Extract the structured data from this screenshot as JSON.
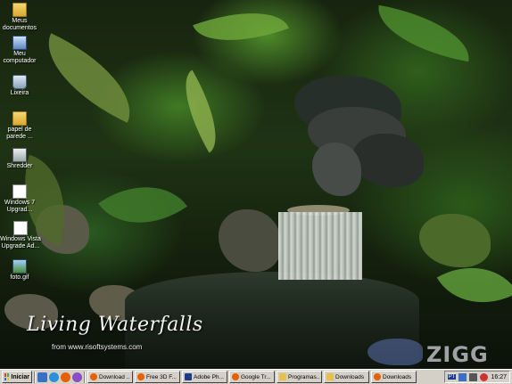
{
  "desktop": {
    "icons": [
      {
        "label": "Meus\ndocumentos",
        "icon": "my-documents-folder-icon"
      },
      {
        "label": "Meu\ncomputador",
        "icon": "my-computer-icon"
      },
      {
        "label": "Lixeira",
        "icon": "recycle-bin-icon"
      },
      {
        "label": "papel de\nparede ...",
        "icon": "folder-icon"
      },
      {
        "label": "Shredder",
        "icon": "shredder-icon"
      },
      {
        "label": "Windows 7\nUpgrad...",
        "icon": "document-icon"
      },
      {
        "label": "Windows Vista\nUpgrade Ad...",
        "icon": "document-icon"
      },
      {
        "label": "foto.gif",
        "icon": "image-file-icon"
      }
    ]
  },
  "wallpaper": {
    "brand": "Living Waterfalls",
    "url": "from www.risoftsystems.com",
    "watermark": "ZIGG"
  },
  "taskbar": {
    "start_label": "Iniciar",
    "quick_launch": [
      "show-desktop-icon",
      "internet-explorer-icon",
      "media-player-icon",
      "browser-icon"
    ],
    "buttons": [
      {
        "label": "Download ...",
        "icon": "firefox-icon"
      },
      {
        "label": "Free 3D F...",
        "icon": "firefox-icon"
      },
      {
        "label": "Adobe Ph...",
        "icon": "photoshop-icon"
      },
      {
        "label": "Google Tr...",
        "icon": "firefox-icon"
      },
      {
        "label": "Programas...",
        "icon": "folder-icon"
      },
      {
        "label": "Downloads",
        "icon": "folder-icon"
      },
      {
        "label": "Downloads",
        "icon": "firefox-icon"
      }
    ],
    "tray": {
      "icons": [
        "pt-language-icon",
        "network-icon",
        "volume-icon",
        "antivirus-icon"
      ],
      "language": "PT",
      "clock": "16:27"
    }
  },
  "colors": {
    "taskbar_bg": "#d4d0c8",
    "firefox": "#e66000",
    "folder": "#e8c04a",
    "photoshop": "#1e3a8a"
  }
}
